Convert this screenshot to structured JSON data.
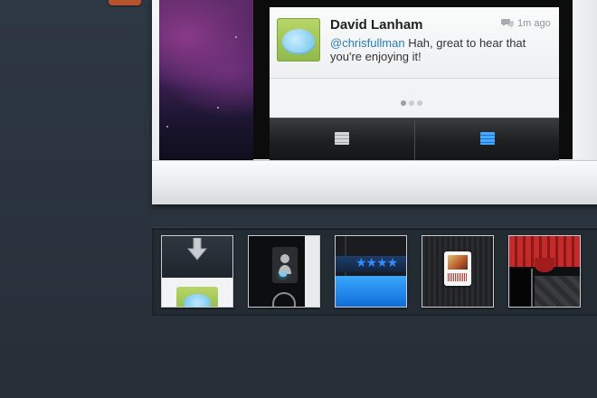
{
  "tweet": {
    "author": "David Lanham",
    "time": "1m ago",
    "mention": "@chrisfullman",
    "message": "Hah, great to hear that you're enjoying it!"
  },
  "pager": {
    "total": 3,
    "active": 1
  },
  "tabs": [
    {
      "icon": "list-icon",
      "state": "inactive"
    },
    {
      "icon": "list-icon",
      "state": "active",
      "accent": "#2f8dff"
    }
  ],
  "thumbnails": [
    {
      "name": "thumb-tweet-arrow"
    },
    {
      "name": "thumb-profile-dark"
    },
    {
      "name": "thumb-rating-blue",
      "stars": "★★★★"
    },
    {
      "name": "thumb-ticket-card"
    },
    {
      "name": "thumb-red-curtain"
    }
  ]
}
